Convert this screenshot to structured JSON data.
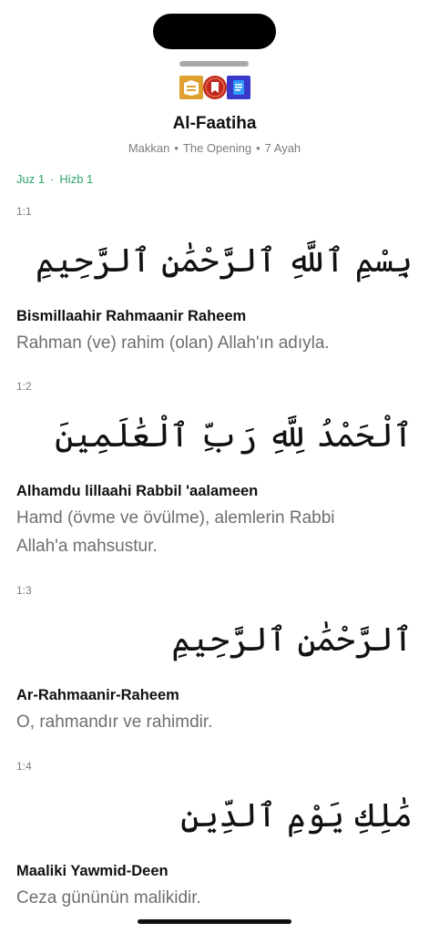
{
  "header": {
    "sources": [
      {
        "name": "kaaba-book-icon",
        "color": "#e0a030"
      },
      {
        "name": "red-book-icon",
        "color": "#c0281e"
      },
      {
        "name": "document-icon",
        "color": "#3a38c8"
      }
    ],
    "title": "Al-Faatiha",
    "meta": [
      "Makkan",
      "The Opening",
      "7 Ayah"
    ],
    "meta_separator": "•"
  },
  "location": {
    "juz": "Juz 1",
    "hizb": "Hizb 1",
    "separator": "·",
    "color": "#2ea36a"
  },
  "tajweed_colors": {
    "silent": "#8a8a8a",
    "madd": "#e88e12",
    "idgham": "#2b8fd6"
  },
  "ayahs": [
    {
      "number": "1:1",
      "arabic": "بِسْمِ ٱللَّهِ ٱلرَّحْمَٰنِ ٱلرَّحِيمِ",
      "transliteration": "Bismillaahir Rahmaanir Raheem",
      "translation": "Rahman (ve) rahim (olan) Allah'ın adıyla."
    },
    {
      "number": "1:2",
      "arabic": "ٱلْحَمْدُ لِلَّهِ رَبِّ ٱلْعَٰلَمِينَ",
      "transliteration": "Alhamdu lillaahi Rabbil 'aalameen",
      "translation": "Hamd (övme ve övülme), alemlerin Rabbi Allah'a mahsustur."
    },
    {
      "number": "1:3",
      "arabic": "ٱلرَّحْمَٰنِ ٱلرَّحِيمِ",
      "transliteration": "Ar-Rahmaanir-Raheem",
      "translation": "O, rahmandır ve rahimdir."
    },
    {
      "number": "1:4",
      "arabic": "مَٰلِكِ يَوْمِ ٱلدِّينِ",
      "transliteration": "Maaliki Yawmid-Deen",
      "translation": "Ceza gününün malikidir."
    }
  ]
}
